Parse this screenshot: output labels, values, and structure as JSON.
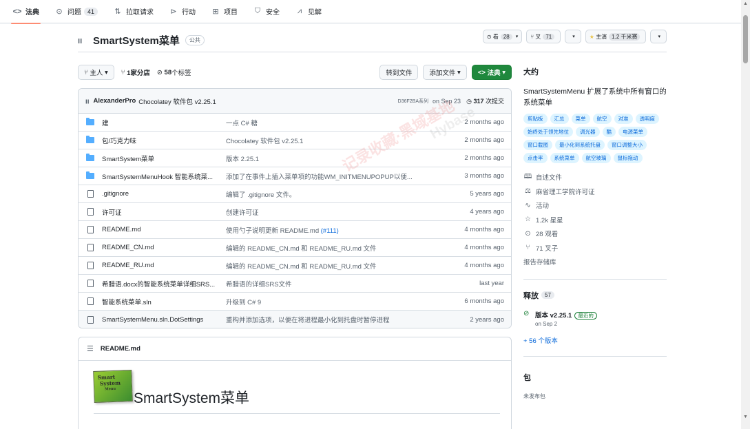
{
  "nav": {
    "tabs": [
      {
        "label": "法典",
        "icon": "code-icon",
        "active": true
      },
      {
        "label": "问题",
        "icon": "issue-icon",
        "count": "41"
      },
      {
        "label": "拉取请求",
        "icon": "pull-request-icon"
      },
      {
        "label": "行动",
        "icon": "actions-icon"
      },
      {
        "label": "项目",
        "icon": "table-icon"
      },
      {
        "label": "安全",
        "icon": "shield-icon"
      },
      {
        "label": "见解",
        "icon": "graph-icon"
      }
    ]
  },
  "repo": {
    "name": "SmartSystem菜单",
    "visibility": "公共",
    "watch": {
      "label": "看",
      "count": "28"
    },
    "fork": {
      "label": "叉",
      "count": "71"
    },
    "star": {
      "label": "主演",
      "count": "1.2 千米赛"
    }
  },
  "branch": {
    "current": "主人",
    "branches": "1家分店",
    "tags_count": "58",
    "tags_label": "个标签",
    "goto_file": "转到文件",
    "add_file": "添加文件",
    "code": "法典"
  },
  "latest_commit": {
    "author": "AlexanderPro",
    "message": "Chocolatey 软件包 v2.25.1",
    "sha": "D36F2BA系列",
    "date": "on Sep 23",
    "commits_count": "317",
    "commits_label": "次提交"
  },
  "files": [
    {
      "type": "dir",
      "name": "建",
      "message": "一点 C# 糖",
      "date": "2 months ago"
    },
    {
      "type": "dir",
      "name": "包/巧克力味",
      "message": "Chocolatey 软件包 v2.25.1",
      "date": "2 months ago"
    },
    {
      "type": "dir",
      "name": "SmartSystem菜单",
      "message": "版本 2.25.1",
      "date": "2 months ago"
    },
    {
      "type": "dir",
      "name": "SmartSystemMenuHook 智能系统菜...",
      "message": "添加了在事件上插入菜单项的功能WM_INITMENUPOPUP以便...",
      "date": "3 months ago"
    },
    {
      "type": "file",
      "name": ".gitignore",
      "message": "编辑了 .gitignore 文件。",
      "date": "5 years ago"
    },
    {
      "type": "file",
      "name": "许可证",
      "message": "创建许可证",
      "date": "4 years ago"
    },
    {
      "type": "file",
      "name": "README.md",
      "message": "使用勺子说明更新 README.md",
      "message_link": "(#111)",
      "date": "4 months ago"
    },
    {
      "type": "file",
      "name": "README_CN.md",
      "message": "编辑的 README_CN.md 和 README_RU.md 文件",
      "date": "4 months ago"
    },
    {
      "type": "file",
      "name": "README_RU.md",
      "message": "编辑的 README_CN.md 和 README_RU.md 文件",
      "date": "4 months ago"
    },
    {
      "type": "file",
      "name": "希腊语.docx的智能系统菜单详细SRS...",
      "message": "希腊语的详细SRS文件",
      "date": "last year"
    },
    {
      "type": "file",
      "name": "智能系统菜单.sln",
      "message": "升级到 C# 9",
      "date": "6 months ago"
    },
    {
      "type": "file",
      "name": "SmartSystemMenu.sln.DotSettings",
      "message": "重构并添加选项，以便在将进程最小化到托盘时暂停进程",
      "date": "2 years ago",
      "highlight": true
    }
  ],
  "readme": {
    "filename": "README.md",
    "logo_lines": [
      "Smart",
      "System",
      "Menu"
    ],
    "title": "SmartSystem菜单"
  },
  "about": {
    "heading": "大约",
    "description": "SmartSystemMenu 扩展了系统中所有窗口的系统菜单",
    "topics": [
      "剪贴板",
      "汇总",
      "菜单",
      "航空",
      "对准",
      "透明度",
      "始终处于领先地位",
      "调光器",
      "酷",
      "电源菜单",
      "窗口截图",
      "最小化到系统托盘",
      "窗口调整大小",
      "点击率",
      "系统菜单",
      "航空玻璃",
      "鼠标拖动"
    ],
    "readme_label": "自述文件",
    "license_label": "麻省理工学院许可证",
    "activity_label": "活动",
    "stars_label": "1.2k 星星",
    "watching_label": "28 观看",
    "forks_label": "71 叉子",
    "report_label": "报告存储库"
  },
  "releases": {
    "heading": "释放",
    "count": "57",
    "latest_name": "版本 v2.25.1",
    "latest_badge": "最近的",
    "latest_date": "on Sep 2",
    "more": "+ 56 个版本"
  },
  "packages": {
    "heading": "包",
    "none": "未发布包"
  },
  "watermark": {
    "line1": "记录收藏·黑域基地",
    "line2": "Hybase"
  }
}
